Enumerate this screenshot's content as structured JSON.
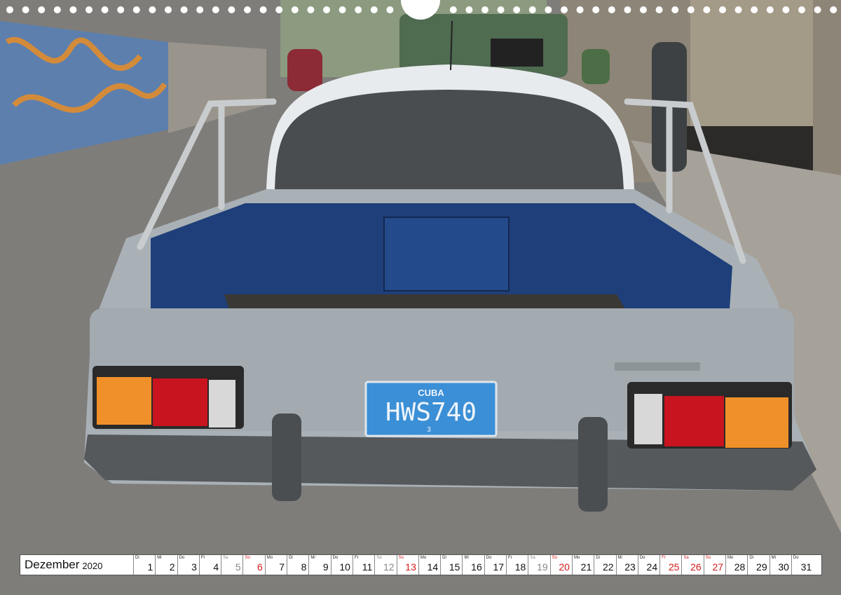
{
  "calendar": {
    "month": "Dezember",
    "year": "2020",
    "days": [
      {
        "wd": "Di",
        "d": "1",
        "t": ""
      },
      {
        "wd": "Mi",
        "d": "2",
        "t": ""
      },
      {
        "wd": "Do",
        "d": "3",
        "t": ""
      },
      {
        "wd": "Fr",
        "d": "4",
        "t": ""
      },
      {
        "wd": "Sa",
        "d": "5",
        "t": "sat"
      },
      {
        "wd": "So",
        "d": "6",
        "t": "red"
      },
      {
        "wd": "Mo",
        "d": "7",
        "t": ""
      },
      {
        "wd": "Di",
        "d": "8",
        "t": ""
      },
      {
        "wd": "Mi",
        "d": "9",
        "t": ""
      },
      {
        "wd": "Do",
        "d": "10",
        "t": ""
      },
      {
        "wd": "Fr",
        "d": "11",
        "t": ""
      },
      {
        "wd": "Sa",
        "d": "12",
        "t": "sat"
      },
      {
        "wd": "So",
        "d": "13",
        "t": "red"
      },
      {
        "wd": "Mo",
        "d": "14",
        "t": ""
      },
      {
        "wd": "Di",
        "d": "15",
        "t": ""
      },
      {
        "wd": "Mi",
        "d": "16",
        "t": ""
      },
      {
        "wd": "Do",
        "d": "17",
        "t": ""
      },
      {
        "wd": "Fr",
        "d": "18",
        "t": ""
      },
      {
        "wd": "Sa",
        "d": "19",
        "t": "sat"
      },
      {
        "wd": "So",
        "d": "20",
        "t": "red"
      },
      {
        "wd": "Mo",
        "d": "21",
        "t": ""
      },
      {
        "wd": "Di",
        "d": "22",
        "t": ""
      },
      {
        "wd": "Mi",
        "d": "23",
        "t": ""
      },
      {
        "wd": "Do",
        "d": "24",
        "t": ""
      },
      {
        "wd": "Fr",
        "d": "25",
        "t": "red"
      },
      {
        "wd": "Sa",
        "d": "26",
        "t": "red"
      },
      {
        "wd": "So",
        "d": "27",
        "t": "red"
      },
      {
        "wd": "Mo",
        "d": "28",
        "t": ""
      },
      {
        "wd": "Di",
        "d": "29",
        "t": ""
      },
      {
        "wd": "Mi",
        "d": "30",
        "t": ""
      },
      {
        "wd": "Do",
        "d": "31",
        "t": ""
      }
    ]
  },
  "plate": {
    "country": "CUBA",
    "number": "HWS740",
    "sub": "3"
  },
  "colors": {
    "plate_blue": "#3b8fd6",
    "bed_blue": "#1f3f7a",
    "body_grey": "#a9b1b6",
    "holiday_red": "#d21a1a"
  }
}
